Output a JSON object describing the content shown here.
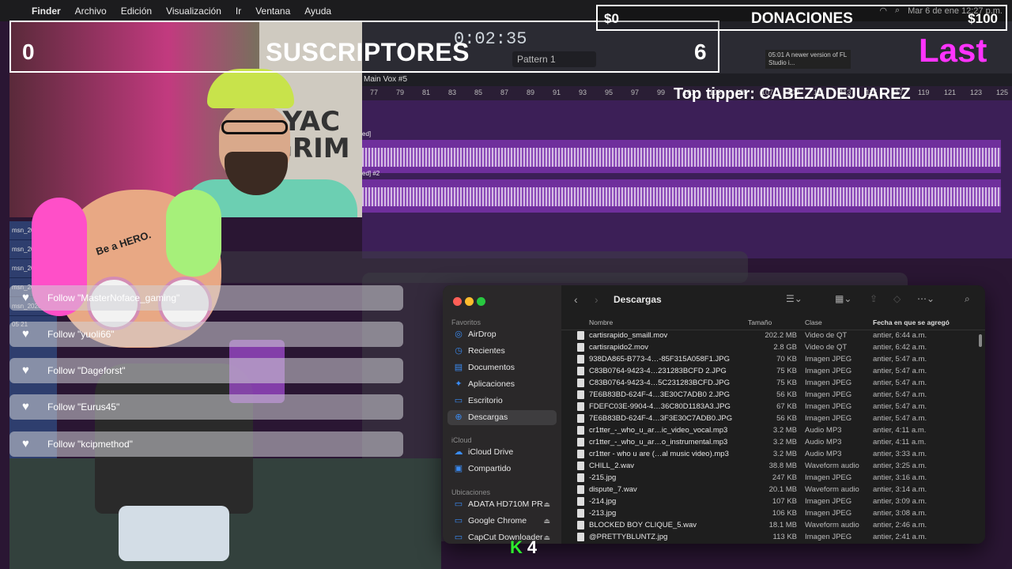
{
  "menubar": {
    "app": "Finder",
    "items": [
      "Archivo",
      "Edición",
      "Visualización",
      "Ir",
      "Ventana",
      "Ayuda"
    ],
    "datetime": "Mar 6 de ene 12:27 p.m."
  },
  "overlay": {
    "subs_count": "0",
    "subs_title": "SUSCRIPTORES",
    "subs_goal": "6",
    "donations_amount": "$0",
    "donations_title": "DONACIONES",
    "donations_goal": "$100",
    "top_tipper": "Top tipper: CABEZADEJUAREZ",
    "last_label": "Last",
    "kick_number": "4"
  },
  "fl_studio": {
    "time": "0:02:35",
    "pattern": "Pattern 1",
    "track_title": "Main Vox #5",
    "news": "05:01 A newer version of FL Studio i...",
    "ruler": [
      "77",
      "79",
      "81",
      "83",
      "85",
      "87",
      "89",
      "91",
      "93",
      "95",
      "97",
      "99",
      "101",
      "103",
      "105",
      "107",
      "109",
      "111",
      "113",
      "115",
      "117",
      "119",
      "121",
      "123",
      "125"
    ],
    "lanes": [
      "ed]",
      "ed] #2"
    ]
  },
  "track_names": [
    "msn_2026",
    "msn_2026",
    "msn_2026",
    "msn_2026-0",
    "msn_2026-01-05 21"
  ],
  "follows": [
    {
      "text": "Follow \"MasterNoface_gaming\""
    },
    {
      "text": "Follow \"yuoli66\""
    },
    {
      "text": "Follow \"Dageforst\""
    },
    {
      "text": "Follow \"Eurus45\""
    },
    {
      "text": "Follow \"kcipmethod\""
    }
  ],
  "mascot_text": "Be a HERO.",
  "finder": {
    "title": "Descargas",
    "sidebar": {
      "favorites_header": "Favoritos",
      "favorites": [
        {
          "label": "AirDrop",
          "icon": "airdrop-icon",
          "glyph": "◎"
        },
        {
          "label": "Recientes",
          "icon": "clock-icon",
          "glyph": "◷"
        },
        {
          "label": "Documentos",
          "icon": "document-icon",
          "glyph": "▤"
        },
        {
          "label": "Aplicaciones",
          "icon": "apps-icon",
          "glyph": "✦"
        },
        {
          "label": "Escritorio",
          "icon": "desktop-icon",
          "glyph": "▭"
        },
        {
          "label": "Descargas",
          "icon": "download-icon",
          "glyph": "⊕"
        }
      ],
      "icloud_header": "iCloud",
      "icloud": [
        {
          "label": "iCloud Drive",
          "icon": "cloud-icon",
          "glyph": "☁"
        },
        {
          "label": "Compartido",
          "icon": "shared-folder-icon",
          "glyph": "▣"
        }
      ],
      "locations_header": "Ubicaciones",
      "locations": [
        {
          "label": "ADATA HD710M PR",
          "icon": "drive-icon",
          "glyph": "▭"
        },
        {
          "label": "Google Chrome",
          "icon": "drive-icon",
          "glyph": "▭"
        },
        {
          "label": "CapCut Downloader",
          "icon": "drive-icon",
          "glyph": "▭"
        }
      ]
    },
    "columns": {
      "name": "Nombre",
      "size": "Tamaño",
      "kind": "Clase",
      "date": "Fecha en que se agregó"
    },
    "rows": [
      {
        "name": "cartisrapido_smaill.mov",
        "size": "202.2 MB",
        "kind": "Video de QT",
        "date": "antier, 6:44 a.m."
      },
      {
        "name": "cartisrapido2.mov",
        "size": "2.8 GB",
        "kind": "Video de QT",
        "date": "antier, 6:42 a.m."
      },
      {
        "name": "938DA865-B773-4…-85F315A058F1.JPG",
        "size": "70 KB",
        "kind": "Imagen JPEG",
        "date": "antier, 5:47 a.m."
      },
      {
        "name": "C83B0764-9423-4…231283BCFD 2.JPG",
        "size": "75 KB",
        "kind": "Imagen JPEG",
        "date": "antier, 5:47 a.m."
      },
      {
        "name": "C83B0764-9423-4…5C231283BCFD.JPG",
        "size": "75 KB",
        "kind": "Imagen JPEG",
        "date": "antier, 5:47 a.m."
      },
      {
        "name": "7E6B83BD-624F-4…3E30C7ADB0 2.JPG",
        "size": "56 KB",
        "kind": "Imagen JPEG",
        "date": "antier, 5:47 a.m."
      },
      {
        "name": "FDEFC03E-9904-4…36C80D1183A3.JPG",
        "size": "67 KB",
        "kind": "Imagen JPEG",
        "date": "antier, 5:47 a.m."
      },
      {
        "name": "7E6B83BD-624F-4…3F3E30C7ADB0.JPG",
        "size": "56 KB",
        "kind": "Imagen JPEG",
        "date": "antier, 5:47 a.m."
      },
      {
        "name": "cr1tter_-_who_u_ar…ic_video_vocal.mp3",
        "size": "3.2 MB",
        "kind": "Audio MP3",
        "date": "antier, 4:11 a.m."
      },
      {
        "name": "cr1tter_-_who_u_ar…o_instrumental.mp3",
        "size": "3.2 MB",
        "kind": "Audio MP3",
        "date": "antier, 4:11 a.m."
      },
      {
        "name": "cr1tter - who u are (…al music video).mp3",
        "size": "3.2 MB",
        "kind": "Audio MP3",
        "date": "antier, 3:33 a.m."
      },
      {
        "name": "CHILL_2.wav",
        "size": "38.8 MB",
        "kind": "Waveform audio",
        "date": "antier, 3:25 a.m."
      },
      {
        "name": "-215.jpg",
        "size": "247 KB",
        "kind": "Imagen JPEG",
        "date": "antier, 3:16 a.m."
      },
      {
        "name": "dispute_7.wav",
        "size": "20.1 MB",
        "kind": "Waveform audio",
        "date": "antier, 3:14 a.m."
      },
      {
        "name": "-214.jpg",
        "size": "107 KB",
        "kind": "Imagen JPEG",
        "date": "antier, 3:09 a.m."
      },
      {
        "name": "-213.jpg",
        "size": "106 KB",
        "kind": "Imagen JPEG",
        "date": "antier, 3:08 a.m."
      },
      {
        "name": "BLOCKED BOY CLIQUE_5.wav",
        "size": "18.1 MB",
        "kind": "Waveform audio",
        "date": "antier, 2:46 a.m."
      },
      {
        "name": "@PRETTYBLUNTZ.jpg",
        "size": "113 KB",
        "kind": "Imagen JPEG",
        "date": "antier, 2:41 a.m."
      }
    ]
  },
  "colors": {
    "accent": "#3a8cf5",
    "magenta": "#ff33ff",
    "kick_green": "#2eeb2e"
  }
}
